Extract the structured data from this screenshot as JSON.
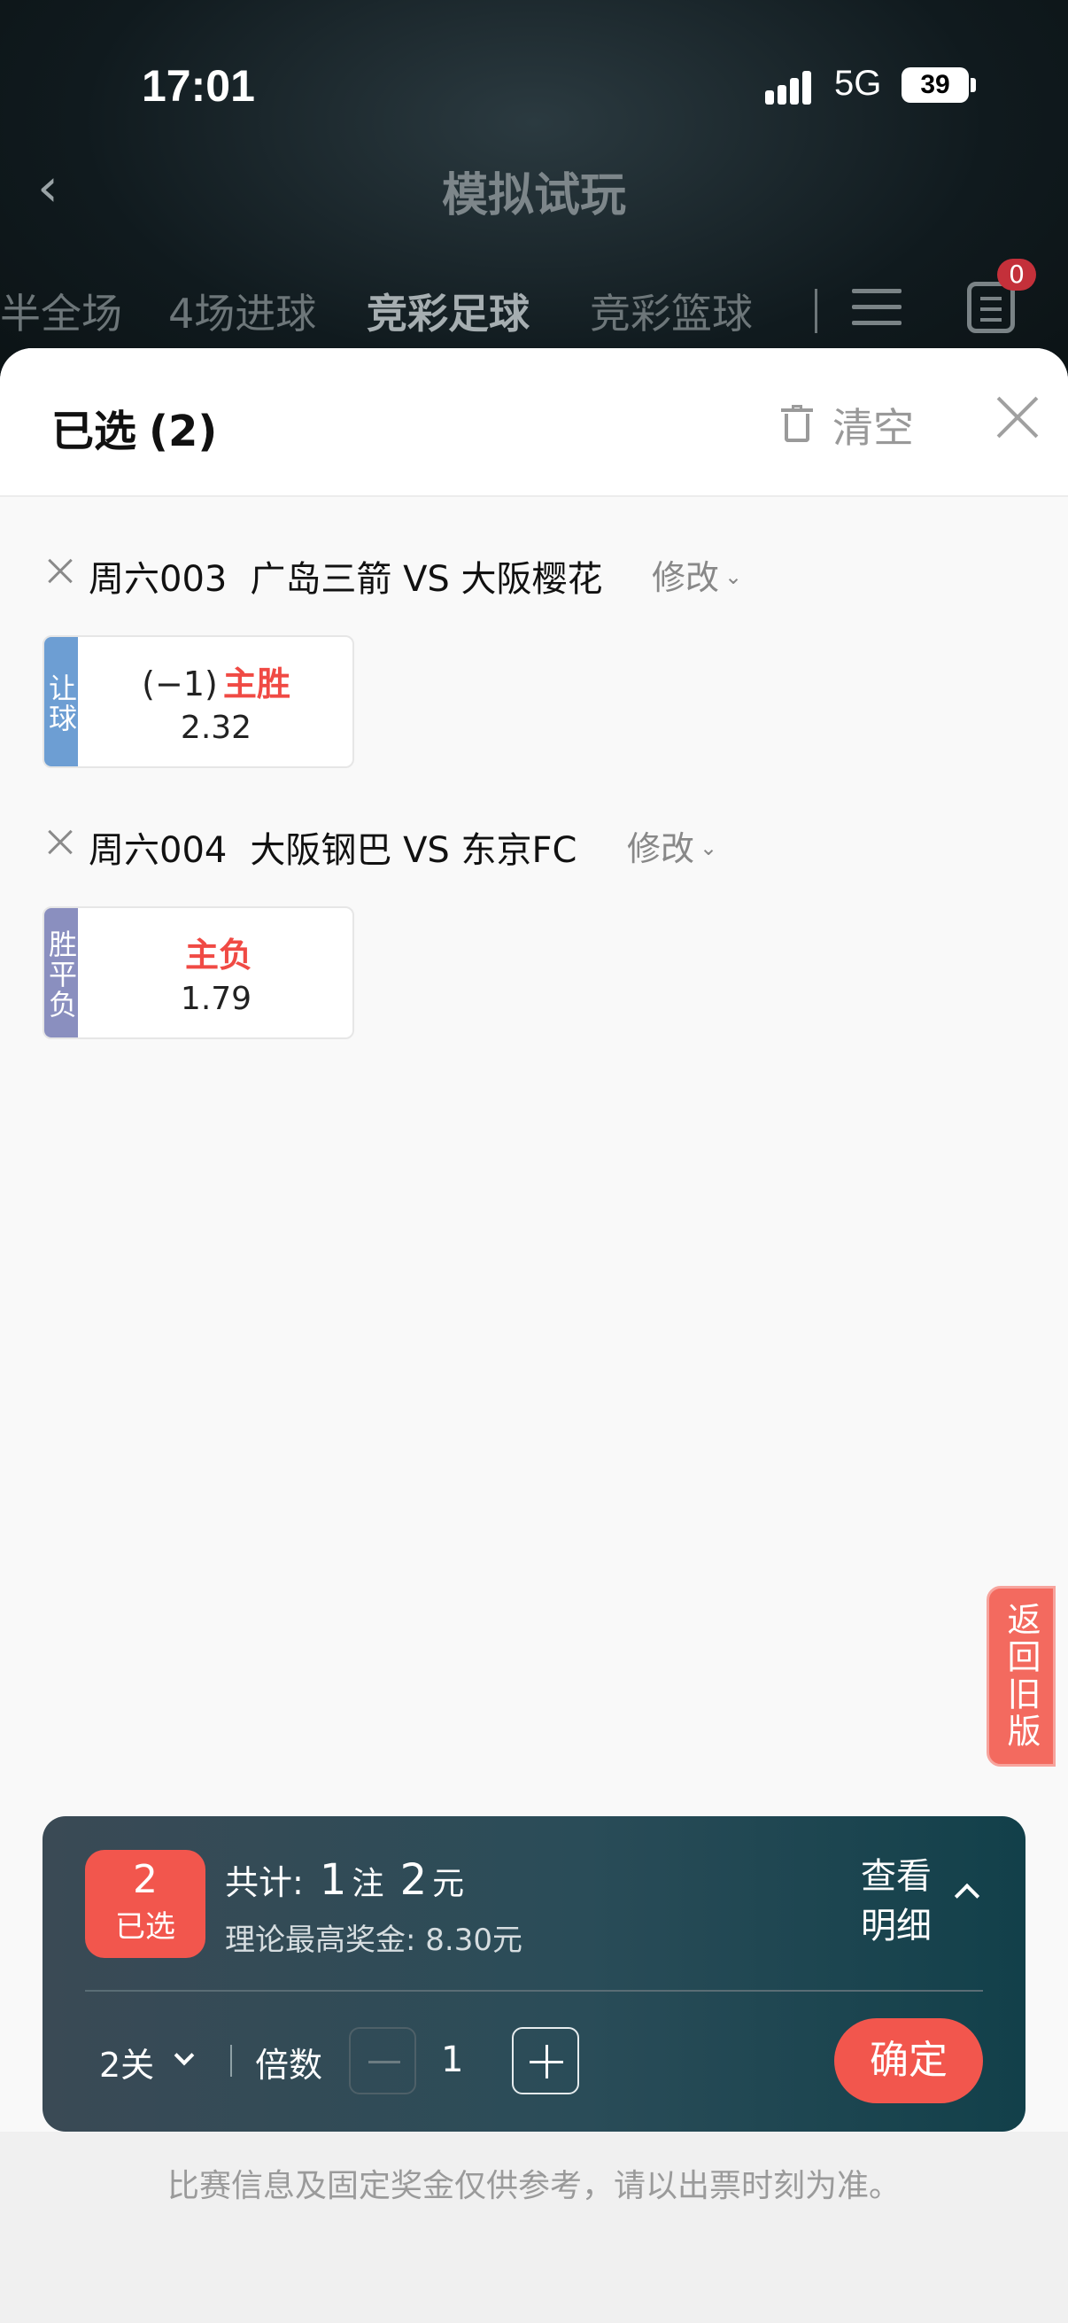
{
  "status": {
    "time": "17:01",
    "network": "5G",
    "battery": "39"
  },
  "header": {
    "title": "模拟试玩",
    "tabs": [
      {
        "label": "半全场",
        "active": false
      },
      {
        "label": "4场进球",
        "active": false
      },
      {
        "label": "竞彩足球",
        "active": true
      },
      {
        "label": "竞彩篮球",
        "active": false
      }
    ],
    "order_badge": "0"
  },
  "sheet": {
    "title": "已选",
    "count": "(2)",
    "clear_label": "清空",
    "matches": [
      {
        "number": "周六003",
        "teams": "广岛三箭 VS 大阪樱花",
        "modify_label": "修改",
        "pick": {
          "tag": "让球",
          "tag_color": "#6d9ed3",
          "handicap": "(−1)",
          "result": "主胜",
          "odds": "2.32"
        }
      },
      {
        "number": "周六004",
        "teams": "大阪钢巴 VS 东京FC",
        "modify_label": "修改",
        "pick": {
          "tag": "胜平负",
          "tag_color": "#8a8fbf",
          "handicap": "",
          "result": "主负",
          "odds": "1.79"
        }
      }
    ],
    "old_version_label": "返回旧版"
  },
  "bet_panel": {
    "selected_count": "2",
    "selected_label": "已选",
    "total_prefix": "共计:",
    "bets": "1",
    "bets_unit": "注",
    "amount": "2",
    "amount_unit": "元",
    "max_prize": "理论最高奖金: 8.30元",
    "detail_label": "查看明细",
    "pass_type": "2关",
    "multiple_label": "倍数",
    "multiple_value": "1",
    "confirm_label": "确定"
  },
  "footer": {
    "note": "比赛信息及固定奖金仅供参考，请以出票时刻为准。"
  },
  "colors": {
    "accent": "#f2564d",
    "panel": "#2a4c58"
  }
}
